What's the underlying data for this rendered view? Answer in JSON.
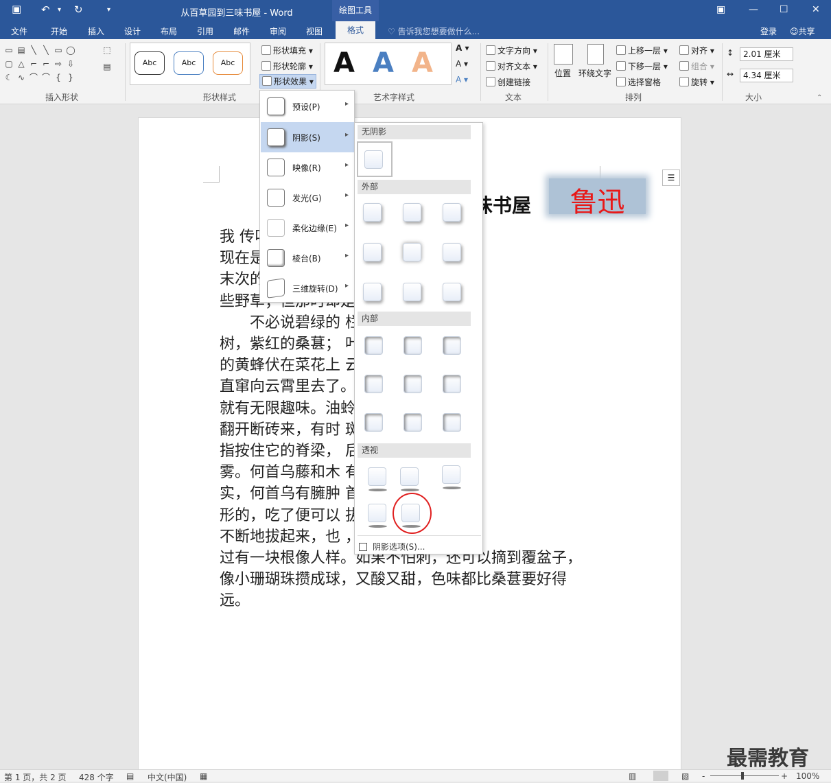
{
  "titlebar": {
    "doc_title": "从百草园到三味书屋 - Word",
    "context_tab": "绘图工具",
    "undo": "↶",
    "redo": "↻",
    "qat_more": "▾",
    "minimize": "—",
    "restore": "☐",
    "close": "✕",
    "ribbon_display": "▣"
  },
  "tabs": {
    "items": [
      "文件",
      "开始",
      "插入",
      "设计",
      "布局",
      "引用",
      "邮件",
      "审阅",
      "视图"
    ],
    "active": "格式",
    "tell_me": "告诉我您想要做什么...",
    "login": "登录",
    "share": "共享"
  },
  "ribbon": {
    "insert_shapes": {
      "label": "插入形状",
      "shapes": [
        "▭",
        "▤",
        "╲",
        "╲",
        "▭",
        "◯",
        "▢",
        "△",
        "⌐",
        "⌐",
        "⇨",
        "⇩",
        "☾",
        "∿",
        "⌒",
        "⌒",
        "{",
        "}"
      ],
      "edit": "⬚",
      "textbox": "▤"
    },
    "shape_styles": {
      "label": "形状样式",
      "samples": [
        "Abc",
        "Abc",
        "Abc"
      ],
      "fill": "形状填充",
      "outline": "形状轮廓",
      "effects": "形状效果"
    },
    "wordart": {
      "label": "艺术字样式",
      "letter": "A"
    },
    "text": {
      "label": "文本",
      "direction": "文字方向",
      "align": "对齐文本",
      "link": "创建链接"
    },
    "arrange": {
      "label": "排列",
      "position": "位置",
      "wrap": "环绕文字",
      "forward": "上移一层",
      "backward": "下移一层",
      "pane": "选择窗格",
      "align": "对齐",
      "group": "组合",
      "rotate": "旋转"
    },
    "size": {
      "label": "大小",
      "height": "2.01 厘米",
      "width": "4.34 厘米"
    }
  },
  "document": {
    "heading_fragment": "味书屋",
    "logo_text": "鲁迅",
    "lines": [
      "我                                      传叫作百草园。",
      "现在是                                  子孙了，连那最",
      "末次的                                  似乎确凿只有一",
      "些野草；但那时却是",
      "　　不必说碧绿的                       栏，高大的皂荚",
      "树，紫红的桑葚；                       叶里长吟，肥胖",
      "的黄蜂伏在菜花上                       云雀)忽然从草间",
      "直窜向云霄里去了。                     的泥墙根一带，",
      "就有无限趣味。油蛉                     们在这里弹琴。",
      "翻开断砖来，有时                       斑蝥，倘若用手",
      "指按住它的脊梁，                       后窍喷出一阵烟",
      "雾。何首乌藤和木                       有莲房一般的果",
      "实，何首乌有臃肿                       首乌根是有像人",
      "形的，吃了便可以                       拔它起来，牵连",
      "不断地拔起来，也                       ，却从来没有见",
      "过有一块根像人样。如果不怕刺，还可以摘到覆盆子，",
      "像小珊瑚珠攒成球，又酸又甜，色味都比桑葚要好得",
      "远。"
    ]
  },
  "effects_menu": {
    "items": [
      {
        "label": "预设(P)"
      },
      {
        "label": "阴影(S)"
      },
      {
        "label": "映像(R)"
      },
      {
        "label": "发光(G)"
      },
      {
        "label": "柔化边缘(E)"
      },
      {
        "label": "棱台(B)"
      },
      {
        "label": "三维旋转(D)"
      }
    ],
    "arrow": "▸"
  },
  "shadow_submenu": {
    "none": "无阴影",
    "outer": "外部",
    "inner": "内部",
    "perspective": "透视",
    "options": "阴影选项(S)..."
  },
  "statusbar": {
    "page": "第 1 页，共 2 页",
    "words": "428 个字",
    "lang": "中文(中国)",
    "zoom": "100%",
    "zoom_minus": "-",
    "zoom_plus": "+"
  },
  "watermark": "最需教育",
  "colors": {
    "brand": "#2b579a",
    "highlight": "#c5d7f0",
    "annotation": "#e02020"
  }
}
